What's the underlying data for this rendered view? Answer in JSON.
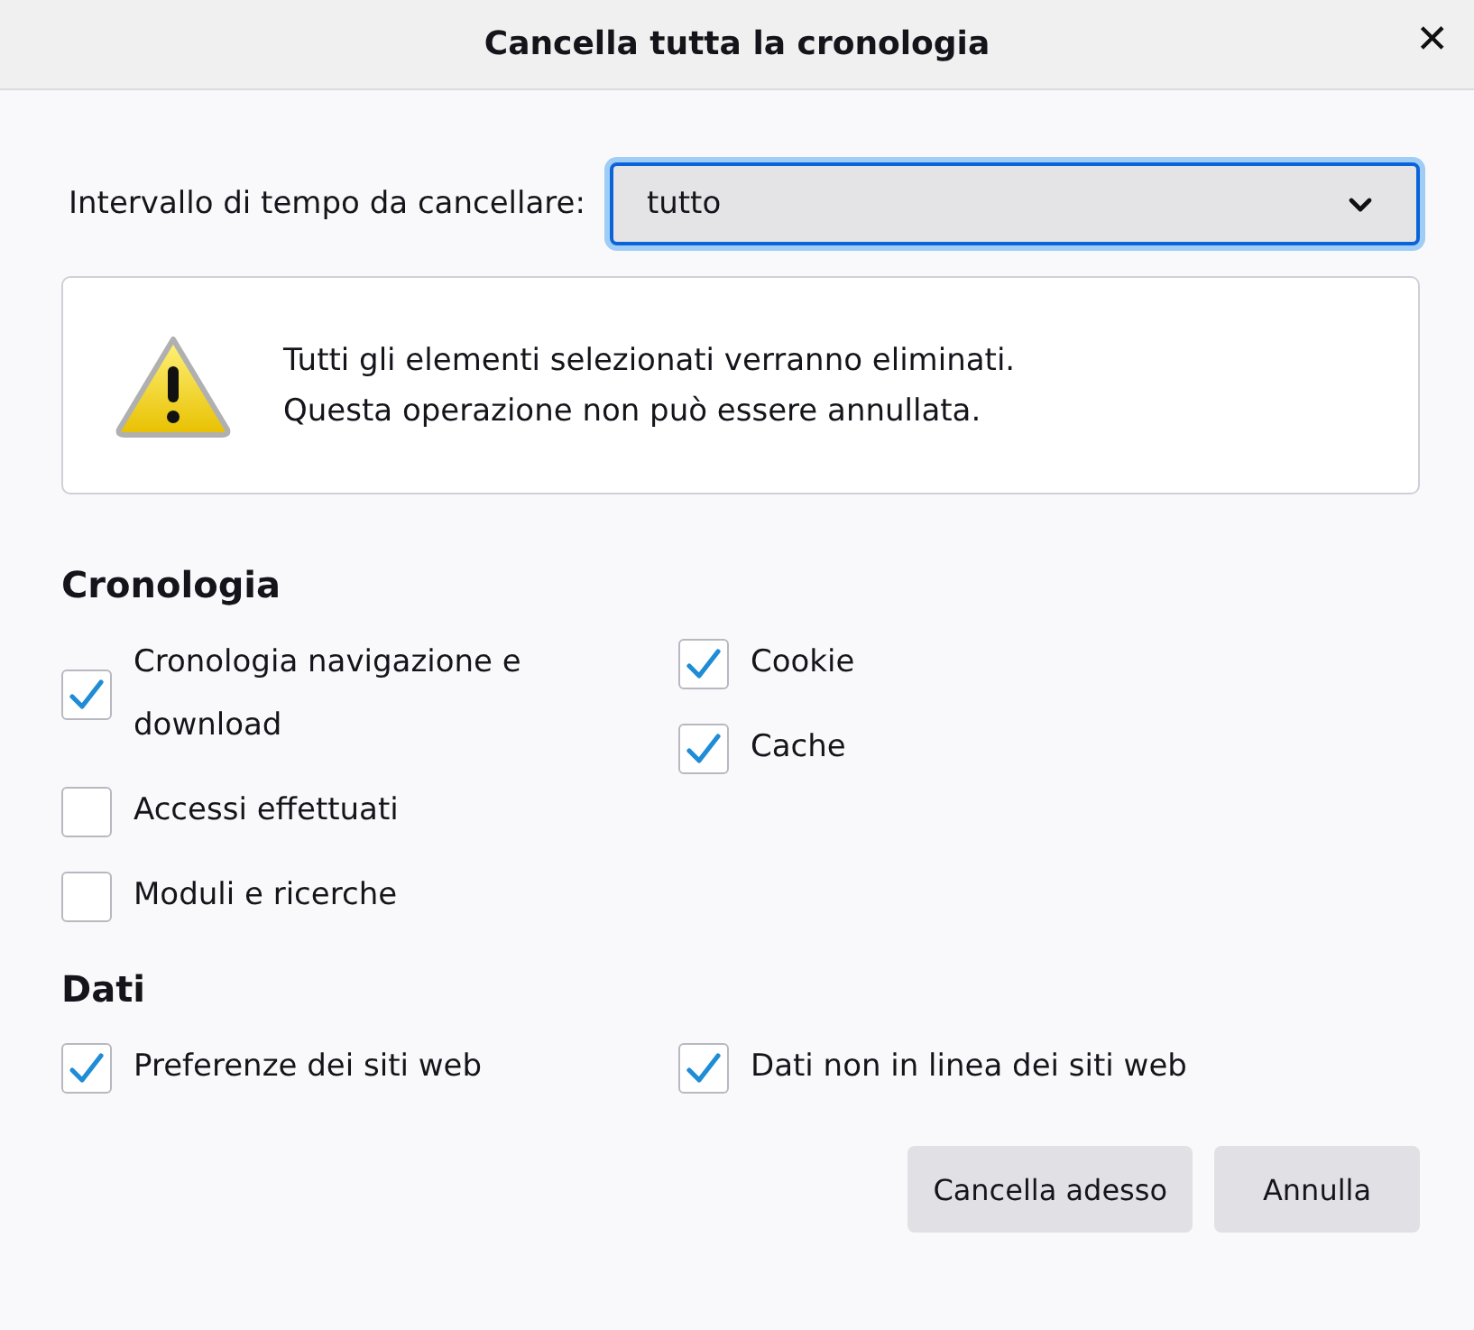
{
  "window": {
    "title": "Cancella tutta la cronologia",
    "close": "✕"
  },
  "time_range": {
    "label": "Intervallo di tempo da cancellare:",
    "value": "tutto"
  },
  "warning": {
    "lines": [
      "Tutti gli elementi selezionati verranno eliminati.",
      "Questa operazione non può essere annullata."
    ]
  },
  "sections": [
    {
      "title": "Cronologia",
      "columns": [
        [
          {
            "label": "Cronologia navigazione e download",
            "checked": true
          },
          {
            "label": "Accessi effettuati",
            "checked": false
          },
          {
            "label": "Moduli e ricerche",
            "checked": false
          }
        ],
        [
          {
            "label": "Cookie",
            "checked": true
          },
          {
            "label": "Cache",
            "checked": true
          }
        ]
      ]
    },
    {
      "title": "Dati",
      "columns": [
        [
          {
            "label": "Preferenze dei siti web",
            "checked": true
          }
        ],
        [
          {
            "label": "Dati non in linea dei siti web",
            "checked": true
          }
        ]
      ]
    }
  ],
  "buttons": [
    "Cancella adesso",
    "Annulla"
  ]
}
